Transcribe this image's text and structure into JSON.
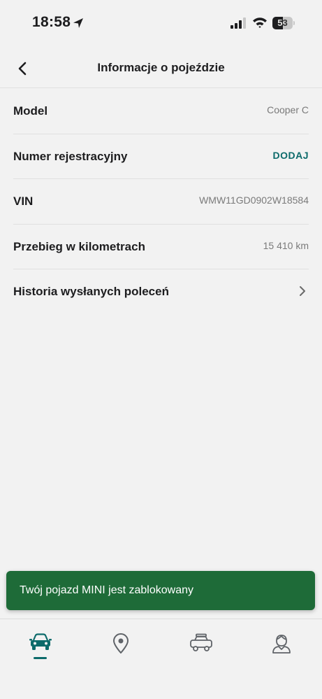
{
  "status_bar": {
    "time": "18:58",
    "battery": "53",
    "battery_level": 0.53
  },
  "header": {
    "title": "Informacje o pojeździe"
  },
  "rows": [
    {
      "label": "Model",
      "value": "Cooper C"
    },
    {
      "label": "Numer rejestracyjny",
      "action": "DODAJ"
    },
    {
      "label": "VIN",
      "value": "WMW11GD0902W18584"
    },
    {
      "label": "Przebieg w kilometrach",
      "value": "15 410 km"
    },
    {
      "label": "Historia wysłanych poleceń"
    }
  ],
  "toast": {
    "message": "Twój pojazd MINI jest zablokowany"
  },
  "tabs": [
    {
      "icon": "car-front-icon",
      "active": true
    },
    {
      "icon": "map-pin-icon",
      "active": false
    },
    {
      "icon": "car-side-icon",
      "active": false
    },
    {
      "icon": "profile-icon",
      "active": false
    }
  ],
  "colors": {
    "accent": "#0d6b6b",
    "toast_bg": "#1e6b38",
    "background": "#f2f2f2"
  }
}
